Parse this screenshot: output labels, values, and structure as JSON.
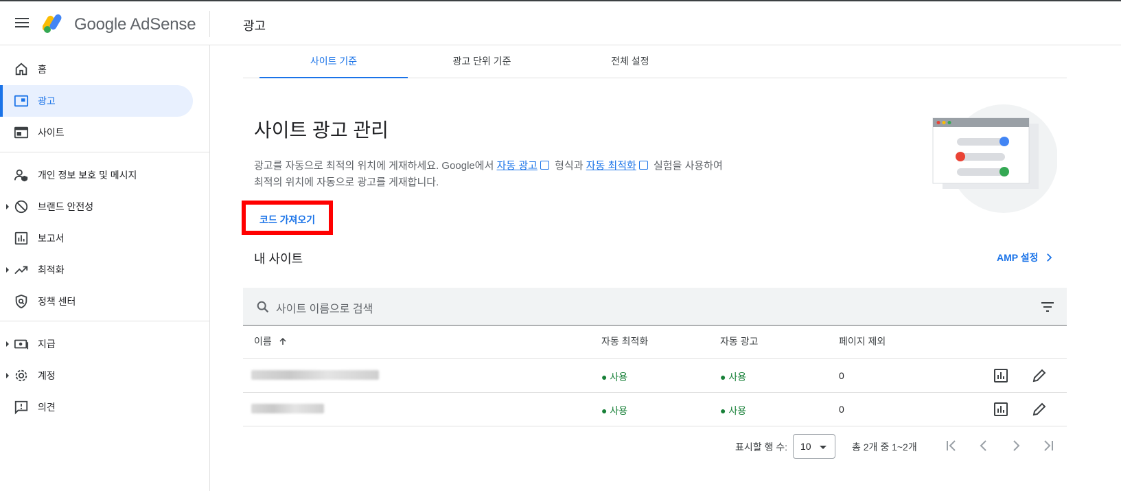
{
  "app": {
    "brand": "Google AdSense",
    "page_title": "광고"
  },
  "sidebar": {
    "items": [
      {
        "label": "홈",
        "icon": "home-icon"
      },
      {
        "label": "광고",
        "icon": "ads-icon",
        "active": true
      },
      {
        "label": "사이트",
        "icon": "site-icon"
      },
      {
        "label": "개인 정보 보호 및 메시지",
        "icon": "privacy-icon"
      },
      {
        "label": "브랜드 안전성",
        "icon": "block-icon"
      },
      {
        "label": "보고서",
        "icon": "report-icon"
      },
      {
        "label": "최적화",
        "icon": "trending-icon"
      },
      {
        "label": "정책 센터",
        "icon": "policy-shield-icon"
      },
      {
        "label": "지급",
        "icon": "payments-icon"
      },
      {
        "label": "계정",
        "icon": "gear-icon"
      },
      {
        "label": "의견",
        "icon": "feedback-icon"
      }
    ]
  },
  "tabs": [
    {
      "label": "사이트 기준",
      "active": true
    },
    {
      "label": "광고 단위 기준"
    },
    {
      "label": "전체 설정"
    }
  ],
  "main": {
    "heading": "사이트 광고 관리",
    "desc_part1": "광고를 자동으로 최적의 위치에 게재하세요. Google에서 ",
    "desc_link1": "자동 광고",
    "desc_part2": " 형식과 ",
    "desc_link2": "자동 최적화",
    "desc_part3": " 실험을 사용하여",
    "desc_line2": "최적의 위치에 자동으로 광고를 게재합니다.",
    "get_code": "코드 가져오기",
    "my_sites": "내 사이트",
    "amp_settings": "AMP 설정"
  },
  "search": {
    "placeholder": "사이트 이름으로 검색"
  },
  "table": {
    "headers": {
      "name": "이름",
      "auto_opt": "자동 최적화",
      "auto_ads": "자동 광고",
      "page_excl": "페이지 제외"
    },
    "rows": [
      {
        "auto_opt": "● 사용",
        "auto_ads": "● 사용",
        "page_excl": "0"
      },
      {
        "auto_opt": "● 사용",
        "auto_ads": "● 사용",
        "page_excl": "0"
      }
    ]
  },
  "pagination": {
    "rows_label": "표시할 행 수:",
    "rows_value": "10",
    "range": "총 2개 중 1~2개"
  },
  "colors": {
    "accent": "#1a73e8",
    "status_on": "#188038",
    "highlight": "#ff0000"
  }
}
